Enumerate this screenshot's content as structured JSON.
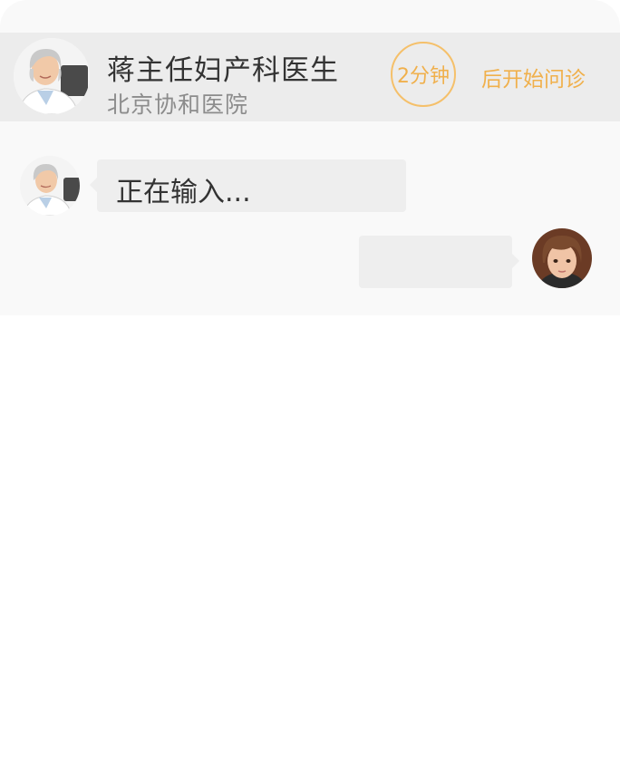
{
  "header": {
    "doctor_name": "蒋主任妇产科医生",
    "hospital": "北京协和医院",
    "timer_value": "2分钟",
    "timer_suffix": "后开始问诊",
    "accent_color": "#f0b04c"
  },
  "messages": [
    {
      "sender": "doctor",
      "text": "正在输入..."
    },
    {
      "sender": "user",
      "text": ""
    }
  ],
  "icons": {
    "doctor_avatar": "doctor-portrait",
    "user_avatar": "user-portrait"
  }
}
